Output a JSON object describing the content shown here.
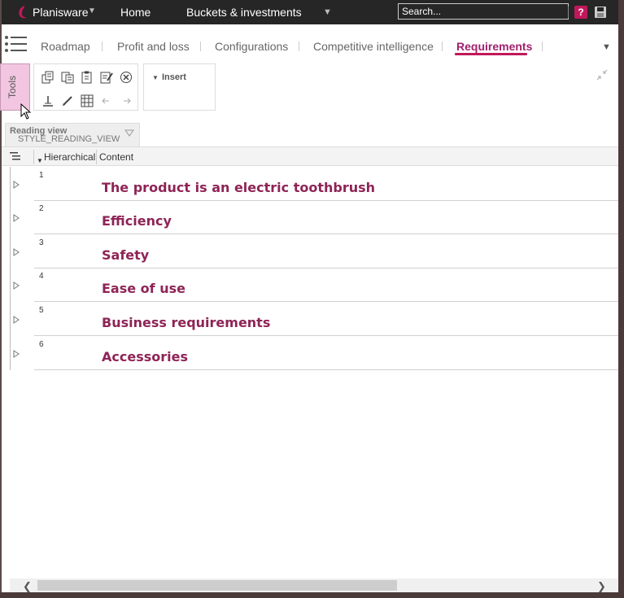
{
  "topbar": {
    "brand": "Planisware",
    "nav": [
      "Home",
      "Buckets & investments"
    ],
    "search_placeholder": "Search...",
    "help_label": "?"
  },
  "tabs": [
    {
      "label": "Roadmap"
    },
    {
      "label": "Profit and loss"
    },
    {
      "label": "Configurations"
    },
    {
      "label": "Competitive intelligence"
    },
    {
      "label": "Requirements",
      "active": true
    }
  ],
  "tools": {
    "tab_label": "Tools",
    "insert_label": "Insert"
  },
  "view": {
    "title": "Reading view",
    "name": "STYLE_READING_VIEW"
  },
  "grid": {
    "columns": [
      "Hierarchical",
      "Content"
    ],
    "rows": [
      {
        "num": "1",
        "title": "The product is an electric toothbrush"
      },
      {
        "num": "2",
        "title": "Efficiency"
      },
      {
        "num": "3",
        "title": "Safety"
      },
      {
        "num": "4",
        "title": "Ease of use"
      },
      {
        "num": "5",
        "title": "Business requirements"
      },
      {
        "num": "6",
        "title": "Accessories"
      }
    ]
  },
  "colors": {
    "accent": "#c2185b",
    "title_text": "#8e2456",
    "topbar_bg": "#262626",
    "tools_bg": "#f2c6e0"
  }
}
